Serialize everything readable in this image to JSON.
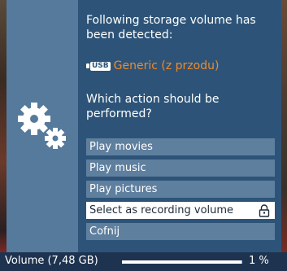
{
  "dialog": {
    "message": "Following storage volume has been detected:",
    "device": {
      "icon": "usb-icon",
      "usb_label": "USB",
      "name": "Generic (z przodu)",
      "color": "#f08a2a"
    },
    "question": "Which action should be performed?",
    "side_icon": "gears-icon",
    "actions": [
      {
        "label": "Play movies"
      },
      {
        "label": "Play music"
      },
      {
        "label": "Play pictures"
      },
      {
        "label": "Select as recording volume",
        "selected": true,
        "icon": "lock-icon"
      },
      {
        "label": "Cofnij"
      }
    ]
  },
  "status": {
    "volume_label": "Volume (7,48 GB)",
    "usage_fraction": 0.99,
    "percent_text": "1 %"
  },
  "colors": {
    "dialog_bg": "#2d5478",
    "side_panel": "#567a9b",
    "button_bg": "#5f7f9f",
    "selected_bg": "#ffffff"
  }
}
